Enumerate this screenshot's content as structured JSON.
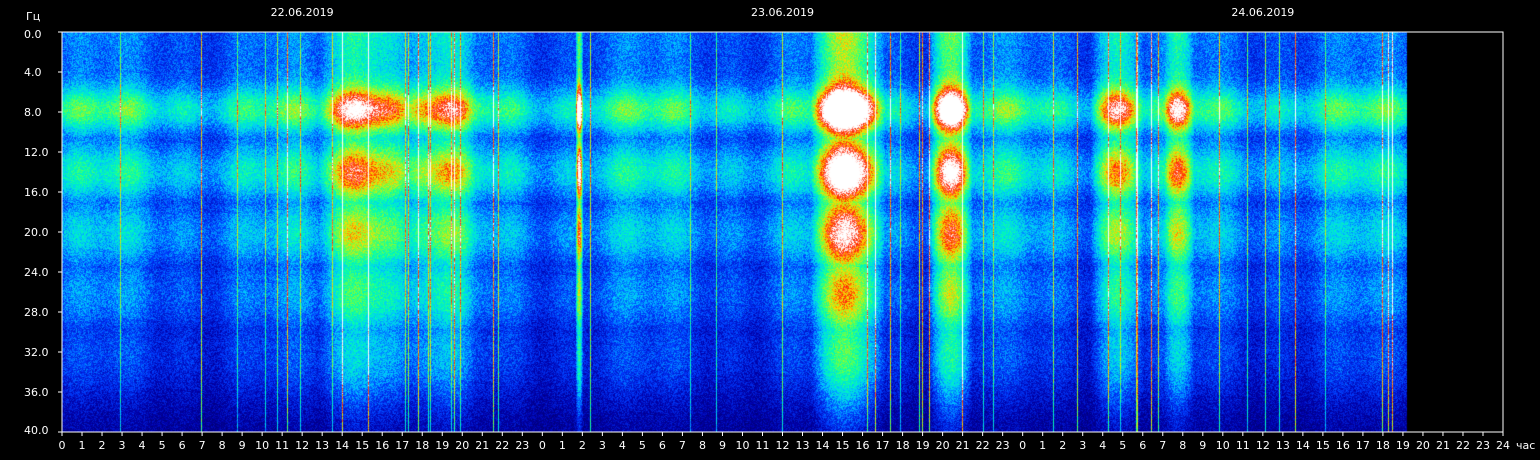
{
  "chart_data": {
    "type": "heatmap",
    "title": "",
    "xlabel": "",
    "ylabel": "Гц",
    "x_unit_label": "час",
    "y_range": [
      0,
      40
    ],
    "y_ticks": [
      "0.0",
      "4.0",
      "8.0",
      "12.0",
      "16.0",
      "20.0",
      "24.0",
      "28.0",
      "32.0",
      "36.0",
      "40.0"
    ],
    "x_ticks": [
      "0",
      "1",
      "2",
      "3",
      "4",
      "5",
      "6",
      "7",
      "8",
      "9",
      "10",
      "11",
      "12",
      "13",
      "14",
      "15",
      "16",
      "17",
      "18",
      "19",
      "20",
      "21",
      "22",
      "23",
      "0",
      "1",
      "2",
      "3",
      "4",
      "5",
      "6",
      "7",
      "8",
      "9",
      "10",
      "11",
      "12",
      "13",
      "14",
      "15",
      "16",
      "17",
      "18",
      "19",
      "20",
      "21",
      "22",
      "23",
      "0",
      "1",
      "2",
      "3",
      "4",
      "5",
      "6",
      "7",
      "8",
      "9",
      "10",
      "11",
      "12",
      "13",
      "14",
      "15",
      "16",
      "17",
      "18",
      "19",
      "20",
      "21",
      "22",
      "23",
      "24"
    ],
    "x_range_hours": [
      0,
      72
    ],
    "data_end_hour": 67.2,
    "dates": [
      {
        "label": "22.06.2019",
        "hour": 12
      },
      {
        "label": "23.06.2019",
        "hour": 36
      },
      {
        "label": "24.06.2019",
        "hour": 60
      }
    ],
    "resonance_bands_hz": [
      7.8,
      14.1,
      20.3,
      26.4,
      32.5
    ],
    "bursts": [
      {
        "start_hour": 13.6,
        "end_hour": 16.8,
        "intensity": 0.75
      },
      {
        "start_hour": 17.5,
        "end_hour": 20.0,
        "intensity": 0.45
      },
      {
        "start_hour": 25.7,
        "end_hour": 25.95,
        "intensity": 1.0
      },
      {
        "start_hour": 38.0,
        "end_hour": 40.5,
        "intensity": 1.0
      },
      {
        "start_hour": 43.6,
        "end_hour": 45.1,
        "intensity": 0.9
      },
      {
        "start_hour": 51.8,
        "end_hour": 53.6,
        "intensity": 0.6
      },
      {
        "start_hour": 55.3,
        "end_hour": 56.3,
        "intensity": 0.5
      }
    ],
    "colors": {
      "background": "#000000",
      "low": "#0000aa",
      "mid": "#00ffb0",
      "high": "#ff2000",
      "peak": "#ffffff"
    }
  }
}
